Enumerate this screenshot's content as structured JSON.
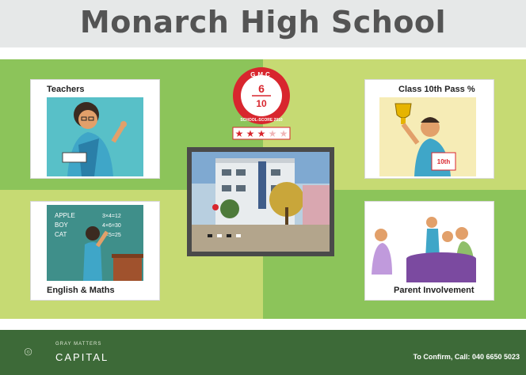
{
  "header": {
    "title": "Monarch High School"
  },
  "badge": {
    "org": "GMC",
    "score_top": "6",
    "score_bottom": "10",
    "ring_text": "SCHOOL-SCORE 2010",
    "stars_filled": 3,
    "stars_total": 5
  },
  "cards": {
    "teachers": {
      "label": "Teachers"
    },
    "pass": {
      "label": "Class 10th Pass %"
    },
    "english": {
      "label": "English & Maths",
      "board_words": [
        "APPLE",
        "BOY",
        "CAT"
      ],
      "board_sums": [
        "3×4=12",
        "4×6=30",
        "4×5=25"
      ]
    },
    "parents": {
      "label": "Parent Involvement"
    }
  },
  "certificate": {
    "text": "10th"
  },
  "footer": {
    "brand_small": "GRAY MATTERS",
    "brand_big": "CAPITAL",
    "confirm_label": "To Confirm, Call:",
    "confirm_phone": "040 6650 5023"
  },
  "colors": {
    "header_bg": "#e6e8e8",
    "green_dark": "#8cc45a",
    "green_light": "#c6da73",
    "footer": "#3d6a38",
    "badge_red": "#d8262e"
  }
}
